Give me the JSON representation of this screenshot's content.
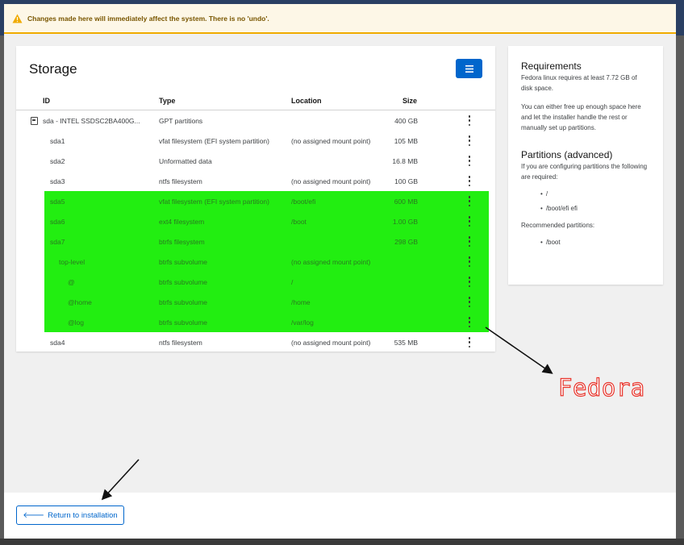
{
  "alert": {
    "text": "Changes made here will immediately affect the system. There is no 'undo'.",
    "icon": "warning-triangle-icon",
    "color": "#f0ab00"
  },
  "storage": {
    "title": "Storage",
    "menu_icon": "hamburger-menu-icon",
    "columns": {
      "id": "ID",
      "type": "Type",
      "location": "Location",
      "size": "Size"
    },
    "rows": [
      {
        "id": "sda - INTEL SSDSC2BA400G...",
        "type": "GPT partitions",
        "location": "",
        "size": "400 GB",
        "indent": 0,
        "icon": "disk-icon",
        "selected": false
      },
      {
        "id": "sda1",
        "type": "vfat filesystem (EFI system partition)",
        "location": "(no assigned mount point)",
        "size": "105 MB",
        "indent": 1,
        "selected": false
      },
      {
        "id": "sda2",
        "type": "Unformatted data",
        "location": "",
        "size": "16.8 MB",
        "indent": 1,
        "selected": false
      },
      {
        "id": "sda3",
        "type": "ntfs filesystem",
        "location": "(no assigned mount point)",
        "size": "100 GB",
        "indent": 1,
        "selected": false
      },
      {
        "id": "sda5",
        "type": "vfat filesystem (EFI system partition)",
        "location": "/boot/efi",
        "size": "600 MB",
        "indent": 1,
        "selected": true
      },
      {
        "id": "sda6",
        "type": "ext4 filesystem",
        "location": "/boot",
        "size": "1.00 GB",
        "indent": 1,
        "selected": true
      },
      {
        "id": "sda7",
        "type": "btrfs filesystem",
        "location": "",
        "size": "298 GB",
        "indent": 1,
        "selected": true
      },
      {
        "id": "top-level",
        "type": "btrfs subvolume",
        "location": "(no assigned mount point)",
        "size": "",
        "indent": 2,
        "selected": true
      },
      {
        "id": "@",
        "type": "btrfs subvolume",
        "location": "/",
        "size": "",
        "indent": 3,
        "selected": true
      },
      {
        "id": "@home",
        "type": "btrfs subvolume",
        "location": "/home",
        "size": "",
        "indent": 3,
        "selected": true
      },
      {
        "id": "@log",
        "type": "btrfs subvolume",
        "location": "/var/log",
        "size": "",
        "indent": 3,
        "selected": true
      },
      {
        "id": "sda4",
        "type": "ntfs filesystem",
        "location": "(no assigned mount point)",
        "size": "535 MB",
        "indent": 1,
        "selected": false
      }
    ]
  },
  "requirements": {
    "title": "Requirements",
    "text1": "Fedora linux requires at least 7.72 GB of disk space.",
    "text2": "You can either free up enough space here and let the installer handle the rest or manually set up partitions.",
    "partitions_title": "Partitions (advanced)",
    "partitions_text": "If you are configuring partitions the following are required:",
    "required": [
      "/",
      "/boot/efi efi"
    ],
    "recommended_label": "Recommended partitions:",
    "recommended": [
      "/boot"
    ]
  },
  "footer": {
    "return_label": "Return to installation",
    "return_icon": "arrow-left-icon"
  },
  "annotation": {
    "brand_text": "Fedora",
    "highlight_color": "#22ee11",
    "brand_color": "#e8332a"
  }
}
